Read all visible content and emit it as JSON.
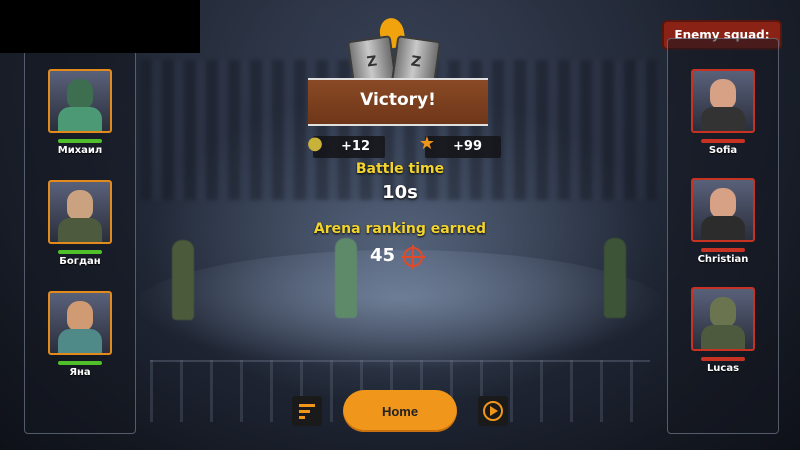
{
  "victory": {
    "title": "Victory!",
    "mug_letter": "Z"
  },
  "rewards": [
    {
      "icon": "money-bag-icon",
      "value": "+12"
    },
    {
      "icon": "star-icon",
      "value": "+99"
    }
  ],
  "battle_time": {
    "label": "Battle time",
    "value": "10s"
  },
  "arena_ranking": {
    "label": "Arena ranking earned",
    "value": "45",
    "icon": "crosshair-icon"
  },
  "player_squad": [
    {
      "name": "Михаил",
      "gear": "gas-mask",
      "hp_color": "#4fc02a"
    },
    {
      "name": "Богдан",
      "gear": "helmet-goggles",
      "hp_color": "#4fc02a"
    },
    {
      "name": "Яна",
      "gear": "goggles",
      "hp_color": "#4fc02a"
    }
  ],
  "enemy_squad": {
    "title": "Enemy squad:",
    "units": [
      {
        "name": "Sofia",
        "gear": "red-cap",
        "hp_color": "#c73222"
      },
      {
        "name": "Christian",
        "gear": "red-cap",
        "hp_color": "#c73222"
      },
      {
        "name": "Lucas",
        "gear": "helmet",
        "hp_color": "#c73222"
      }
    ]
  },
  "buttons": {
    "home": "Home",
    "stats_icon": "bars-icon",
    "replay_icon": "replay-icon"
  },
  "colors": {
    "accent": "#f0961a",
    "banner": "#6e3619",
    "label": "#f3d42e",
    "enemy": "#8a2316"
  }
}
